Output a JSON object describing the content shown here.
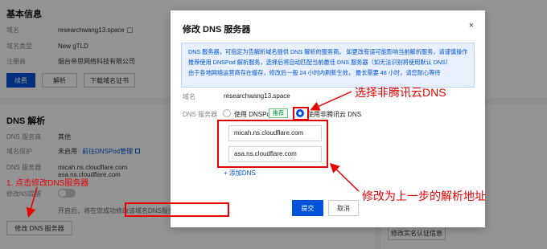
{
  "basic_info": {
    "title": "基本信息",
    "rows": [
      {
        "label": "域名",
        "value": "researchwang13.space"
      },
      {
        "label": "域名类型",
        "value": "New gTLD"
      },
      {
        "label": "注册商",
        "value": "烟台帝思网络科技有限公司"
      }
    ],
    "buttons": {
      "primary": "续费",
      "resolve": "解析",
      "cert": "下载域名证书"
    }
  },
  "dns_section": {
    "title": "DNS 解析",
    "rows": [
      {
        "label": "DNS 服务商",
        "value": "其他"
      },
      {
        "label": "域名保护",
        "value": "未启用"
      },
      {
        "label": "DNS 服务器",
        "value": "micah.ns.cloudflare.com"
      }
    ],
    "dnspod_link": "前往DNSPod管理",
    "dns_server_2": "asa.ns.cloudflare.com",
    "toggle_label": "修改NS提醒",
    "hint_text": "开启后，将在您成功修改该域名DNS服务器后，",
    "modify_button": "修改 DNS 服务器"
  },
  "right_panel": {
    "mail_fragment": "il",
    "modify_auth_button": "修改实名认证信息"
  },
  "dialog": {
    "title": "修改 DNS 服务器",
    "close_icon": "×",
    "notice_lines": [
      "DNS 服务器，可指定为告解析域名提供 DNS 解析的服务商。 如更改有误可能影响当前解析服务，请谨慎操作",
      "推荐使用 DNSPod 解析服务，选择后将自动匹配当前最佳 DNS 服务器（如无法识别将使用默认 DNS）",
      "由于各地网络运营商存在缓存，修改后一般 24 小时内刷新生效， 最长需要 48 小时，请您耐心等待"
    ],
    "domain_label": "域名",
    "domain_value": "researchwang13.space",
    "dns_label": "DNS 服务器",
    "option_dnspod": "使用 DNSPod",
    "recommend_tag": "推荐",
    "option_other": "使用非腾讯云 DNS",
    "ns1": "micah.ns.cloudflare.com",
    "ns2": "asa.ns.cloudflare.com",
    "add_dns": "+ 添加DNS",
    "submit": "提交",
    "cancel": "取消"
  },
  "annotations": {
    "select_non_tencent": "选择非腾讯云DNS",
    "change_to_previous": "修改为上一步的解析地址",
    "click_modify": "1. 点击修改DNS服务器"
  },
  "colors": {
    "accent": "#0052d9",
    "annotation": "#e60000"
  }
}
